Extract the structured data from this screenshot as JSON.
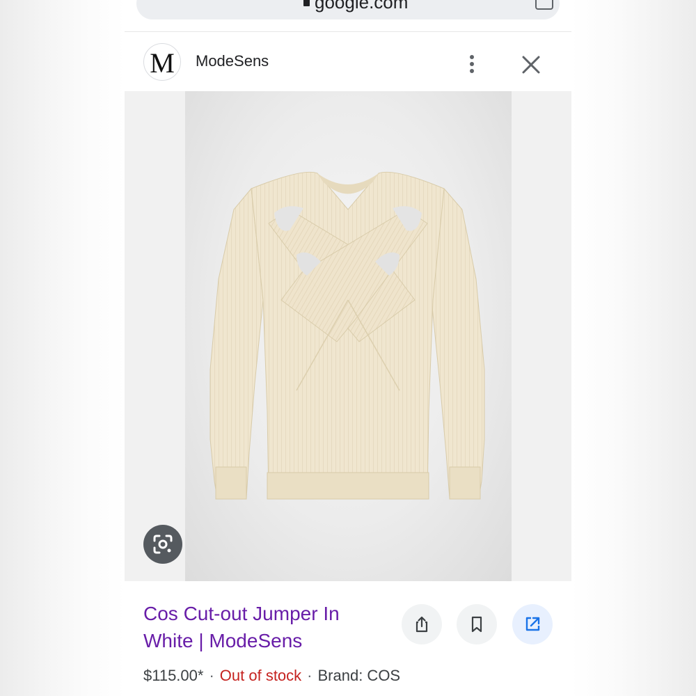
{
  "browser": {
    "url": "google.com"
  },
  "site": {
    "logo_letter": "M",
    "name": "ModeSens"
  },
  "product": {
    "title_line1": "Cos Cut-out Jumper In",
    "title_line2": "White | ModeSens",
    "price": "$115.00*",
    "stock_status": "Out of stock",
    "brand": "Brand: COS",
    "separator": "·"
  },
  "icons": {
    "lock": "lock-icon",
    "tabs": "tab-switcher-icon",
    "more": "more-vert-icon",
    "close": "close-icon",
    "lens": "google-lens-icon",
    "share": "share-icon",
    "bookmark": "bookmark-icon",
    "open": "open-in-new-icon"
  },
  "colors": {
    "title_link": "#681da8",
    "out_of_stock": "#c5221f",
    "primary_action": "#1a73e8",
    "sweater": "#f0e6cf"
  }
}
